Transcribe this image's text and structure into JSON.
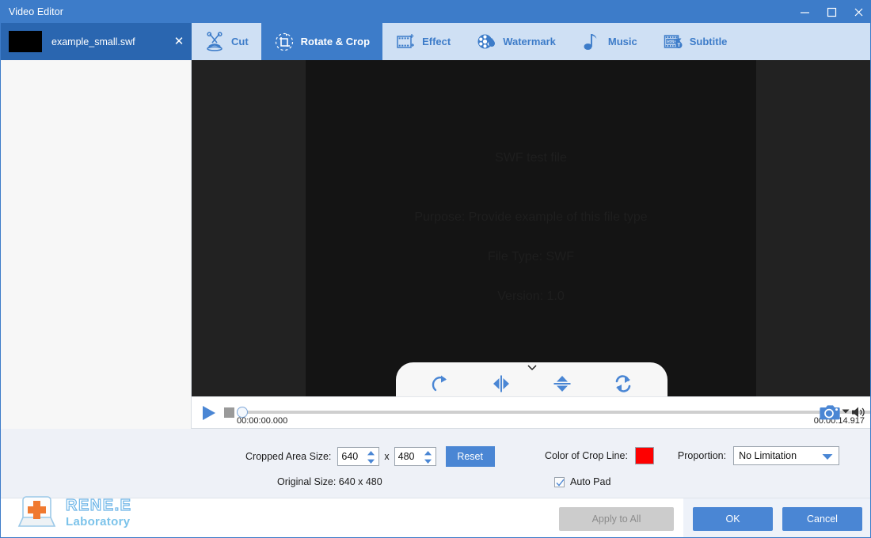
{
  "window": {
    "title": "Video Editor",
    "minimize_label": "—",
    "maximize_label": "□",
    "close_label": "✕"
  },
  "file_tab": {
    "name": "example_small.swf",
    "close_label": "✕"
  },
  "tabs": [
    {
      "id": "cut",
      "label": "Cut",
      "icon": "scissors-icon",
      "active": false
    },
    {
      "id": "rotate-crop",
      "label": "Rotate & Crop",
      "icon": "crop-rotate-icon",
      "active": true
    },
    {
      "id": "effect",
      "label": "Effect",
      "icon": "filmstrip-sparkle-icon",
      "active": false
    },
    {
      "id": "watermark",
      "label": "Watermark",
      "icon": "film-reel-drop-icon",
      "active": false
    },
    {
      "id": "music",
      "label": "Music",
      "icon": "music-note-icon",
      "active": false
    },
    {
      "id": "subtitle",
      "label": "Subtitle",
      "icon": "subtitle-icon",
      "active": false
    }
  ],
  "preview": {
    "line1": "SWF test file",
    "line2": "Purpose: Provide example of this file type",
    "line3": "File Type: SWF",
    "line4": "Version: 1.0",
    "background_color": "#141414",
    "stage_color": "#222222"
  },
  "crop_tools": [
    {
      "id": "rotate-right",
      "icon": "rotate-clockwise-icon"
    },
    {
      "id": "flip-horizontal",
      "icon": "flip-horizontal-icon"
    },
    {
      "id": "flip-vertical",
      "icon": "flip-vertical-icon"
    },
    {
      "id": "rotate-reset",
      "icon": "rotate-swap-icon"
    }
  ],
  "player": {
    "play_icon": "play-icon",
    "stop_icon": "stop-icon",
    "current_time": "00:00:00.000",
    "total_time": "00:00:14.917",
    "progress_percent": 0,
    "snapshot_icon": "camera-icon",
    "snapshot_caret_icon": "chevron-down-icon",
    "volume_icon": "speaker-icon"
  },
  "settings": {
    "cropped_area_label": "Cropped Area Size:",
    "cropped_width": "640",
    "cropped_height": "480",
    "dimension_separator": "x",
    "reset_label": "Reset",
    "original_size_label": "Original Size: 640 x 480",
    "crop_line_color_label": "Color of Crop Line:",
    "crop_line_color": "#FE0000",
    "proportion_label": "Proportion:",
    "proportion_value": "No Limitation",
    "proportion_options": [
      "No Limitation"
    ],
    "auto_pad_label": "Auto Pad",
    "auto_pad_checked": true
  },
  "footer": {
    "logo_line1": "RENE.E",
    "logo_line2": "Laboratory",
    "apply_to_all_label": "Apply to All",
    "ok_label": "OK",
    "cancel_label": "Cancel"
  },
  "colors": {
    "accent": "#3D7CC9",
    "tabstrip": "#CFE0F4",
    "button": "#4A86D4",
    "panel": "#EEF1F7"
  }
}
